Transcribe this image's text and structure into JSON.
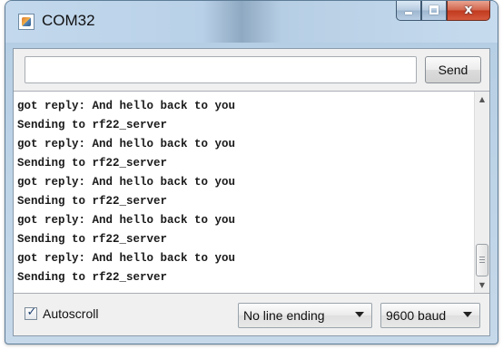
{
  "window": {
    "title": "COM32",
    "controls": {
      "minimize": "minimize",
      "maximize": "maximize",
      "close": "x"
    }
  },
  "send": {
    "input_value": "",
    "button_label": "Send"
  },
  "log": [
    "got reply: And hello back to you",
    "Sending to rf22_server",
    "got reply: And hello back to you",
    "Sending to rf22_server",
    "got reply: And hello back to you",
    "Sending to rf22_server",
    "got reply: And hello back to you",
    "Sending to rf22_server",
    "got reply: And hello back to you",
    "Sending to rf22_server"
  ],
  "footer": {
    "autoscroll": {
      "label": "Autoscroll",
      "checked": true,
      "check_glyph": "✓"
    },
    "line_ending": {
      "selected": "No line ending"
    },
    "baud_rate": {
      "selected": "9600 baud"
    }
  },
  "colors": {
    "title_bar": "#b9d1e8",
    "close_button": "#c0391f",
    "client_background": "#f0f0f0",
    "output_background": "#ffffff"
  },
  "icons": {
    "app": "serial-monitor-icon",
    "scroll_up": "arrow-up-icon",
    "scroll_down": "arrow-down-icon",
    "dropdown": "chevron-down-icon"
  }
}
